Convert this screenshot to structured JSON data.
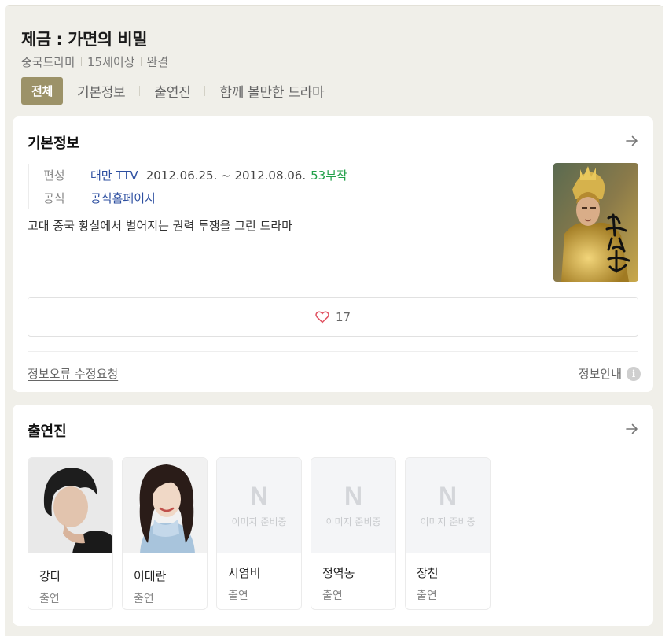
{
  "header": {
    "title": "제금 : 가면의 비밀",
    "meta": [
      "중국드라마",
      "15세이상",
      "완결"
    ]
  },
  "tabs": [
    {
      "label": "전체",
      "active": true
    },
    {
      "label": "기본정보",
      "active": false
    },
    {
      "label": "출연진",
      "active": false
    },
    {
      "label": "함께 볼만한 드라마",
      "active": false
    }
  ],
  "basic": {
    "title": "기본정보",
    "schedule_label": "편성",
    "channel": "대만 TTV",
    "dates": "2012.06.25. ~ 2012.08.06.",
    "episodes": "53부작",
    "official_label": "공식",
    "official_link": "공식홈페이지",
    "description": "고대 중국 황실에서 벌어지는 권력 투쟁을 그린 드라마",
    "like_count": "17",
    "report_link": "정보오류 수정요청",
    "guide_label": "정보안내",
    "guide_icon": "i"
  },
  "cast": {
    "title": "출연진",
    "members": [
      {
        "name": "강타",
        "role": "출연",
        "image": "photo"
      },
      {
        "name": "이태란",
        "role": "출연",
        "image": "photo"
      },
      {
        "name": "시염비",
        "role": "출연",
        "image": "placeholder"
      },
      {
        "name": "정역동",
        "role": "출연",
        "image": "placeholder"
      },
      {
        "name": "장천",
        "role": "출연",
        "image": "placeholder"
      }
    ],
    "placeholder_logo": "N",
    "placeholder_text": "이미지 준비중"
  },
  "colors": {
    "active_tab": "#9c9268",
    "link": "#2d4fa0",
    "episodes": "#20a048",
    "background": "#f0efe9"
  }
}
